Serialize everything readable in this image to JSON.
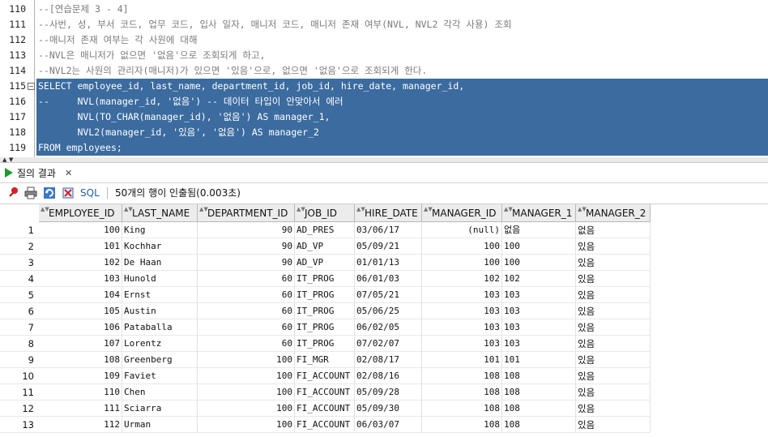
{
  "editor": {
    "lines": [
      {
        "num": "110",
        "text": "--[연습문제 3 - 4]",
        "type": "comment"
      },
      {
        "num": "111",
        "text": "--사번, 성, 부서 코드, 업무 코드, 입사 일자, 매니저 코드, 매니저 존재 여부(NVL, NVL2 각각 사용) 조회",
        "type": "comment"
      },
      {
        "num": "112",
        "text": "--매니저 존재 여부는 각 사원에 대해",
        "type": "comment"
      },
      {
        "num": "113",
        "text": "--NVL은 매니저가 없으면 '없음'으로 조회되게 하고,",
        "type": "comment"
      },
      {
        "num": "114",
        "text": "--NVL2는 사원의 관리자(매니저)가 있으면 '있음'으로, 없으면 '없음'으로 조회되게 한다.",
        "type": "comment"
      },
      {
        "num": "115",
        "text": "SELECT employee_id, last_name, department_id, job_id, hire_date, manager_id,",
        "type": "selected"
      },
      {
        "num": "116",
        "text": "--     NVL(manager_id, '없음') -- 데이터 타입이 안맞아서 에러",
        "type": "selected"
      },
      {
        "num": "117",
        "text": "       NVL(TO_CHAR(manager_id), '없음') AS manager_1,",
        "type": "selected"
      },
      {
        "num": "118",
        "text": "       NVL2(manager_id, '있음', '없음') AS manager_2",
        "type": "selected"
      },
      {
        "num": "119",
        "text": "FROM employees;",
        "type": "selected"
      }
    ]
  },
  "results_tab": {
    "label": "질의 결과"
  },
  "toolbar": {
    "sql_label": "SQL",
    "status": "50개의 행이 인출됨(0.003초)"
  },
  "grid": {
    "columns": [
      "EMPLOYEE_ID",
      "LAST_NAME",
      "DEPARTMENT_ID",
      "JOB_ID",
      "HIRE_DATE",
      "MANAGER_ID",
      "MANAGER_1",
      "MANAGER_2"
    ],
    "rows": [
      [
        "1",
        "100",
        "King",
        "90",
        "AD_PRES",
        "03/06/17",
        "(null)",
        "없음",
        "없음"
      ],
      [
        "2",
        "101",
        "Kochhar",
        "90",
        "AD_VP",
        "05/09/21",
        "100",
        "100",
        "있음"
      ],
      [
        "3",
        "102",
        "De Haan",
        "90",
        "AD_VP",
        "01/01/13",
        "100",
        "100",
        "있음"
      ],
      [
        "4",
        "103",
        "Hunold",
        "60",
        "IT_PROG",
        "06/01/03",
        "102",
        "102",
        "있음"
      ],
      [
        "5",
        "104",
        "Ernst",
        "60",
        "IT_PROG",
        "07/05/21",
        "103",
        "103",
        "있음"
      ],
      [
        "6",
        "105",
        "Austin",
        "60",
        "IT_PROG",
        "05/06/25",
        "103",
        "103",
        "있음"
      ],
      [
        "7",
        "106",
        "Pataballa",
        "60",
        "IT_PROG",
        "06/02/05",
        "103",
        "103",
        "있음"
      ],
      [
        "8",
        "107",
        "Lorentz",
        "60",
        "IT_PROG",
        "07/02/07",
        "103",
        "103",
        "있음"
      ],
      [
        "9",
        "108",
        "Greenberg",
        "100",
        "FI_MGR",
        "02/08/17",
        "101",
        "101",
        "있음"
      ],
      [
        "10",
        "109",
        "Faviet",
        "100",
        "FI_ACCOUNT",
        "02/08/16",
        "108",
        "108",
        "있음"
      ],
      [
        "11",
        "110",
        "Chen",
        "100",
        "FI_ACCOUNT",
        "05/09/28",
        "108",
        "108",
        "있음"
      ],
      [
        "12",
        "111",
        "Sciarra",
        "100",
        "FI_ACCOUNT",
        "05/09/30",
        "108",
        "108",
        "있음"
      ],
      [
        "13",
        "112",
        "Urman",
        "100",
        "FI_ACCOUNT",
        "06/03/07",
        "108",
        "108",
        "있음"
      ]
    ]
  }
}
